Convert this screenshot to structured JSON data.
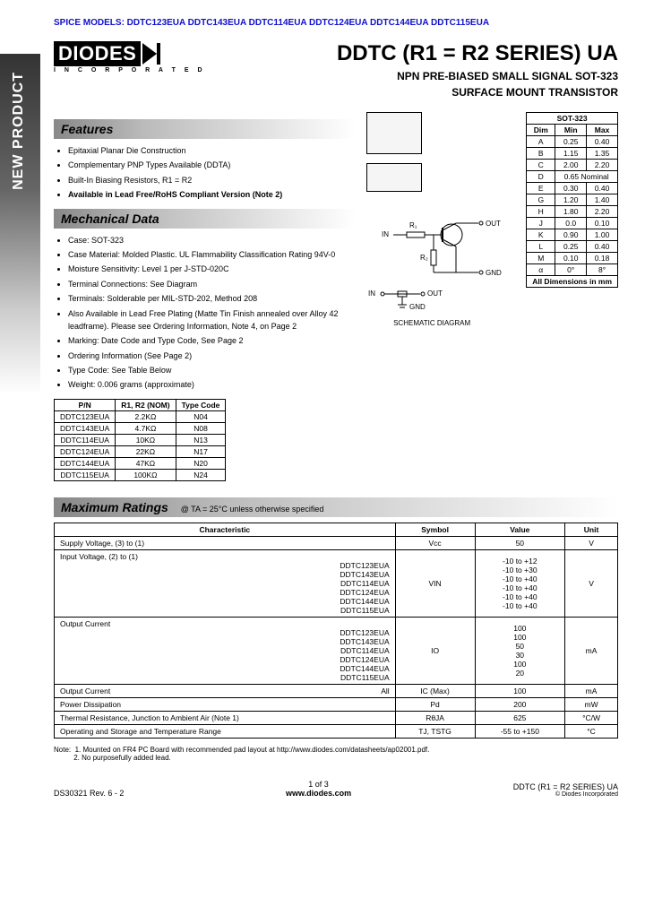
{
  "spice_header": "SPICE MODELS:  DDTC123EUA DDTC143EUA DDTC114EUA DDTC124EUA DDTC144EUA DDTC115EUA",
  "logo": {
    "text": "DIODES",
    "sub": "I N C O R P O R A T E D"
  },
  "title": {
    "main": "DDTC (R1 = R2 SERIES) UA",
    "sub1": "NPN PRE-BIASED SMALL SIGNAL SOT-323",
    "sub2": "SURFACE MOUNT TRANSISTOR"
  },
  "sidebar": "NEW PRODUCT",
  "features": {
    "head": "Features",
    "items": [
      "Epitaxial Planar Die Construction",
      "Complementary PNP Types Available (DDTA)",
      "Built-In Biasing Resistors, R1 = R2",
      "Available in Lead Free/RoHS Compliant Version (Note 2)"
    ]
  },
  "mech": {
    "head": "Mechanical Data",
    "items": [
      "Case: SOT-323",
      "Case Material: Molded Plastic. UL Flammability Classification Rating 94V-0",
      "Moisture Sensitivity: Level 1 per J-STD-020C",
      "Terminal Connections: See Diagram",
      "Terminals: Solderable per MIL-STD-202, Method 208",
      "Also Available in Lead Free Plating (Matte Tin Finish annealed over Alloy 42 leadframe). Please see Ordering Information, Note 4, on Page 2",
      "Marking: Date Code and Type Code, See Page 2",
      "Ordering Information (See Page 2)",
      "Type Code: See Table Below",
      "Weight: 0.006 grams (approximate)"
    ]
  },
  "pn_table": {
    "headers": [
      "P/N",
      "R1, R2 (NOM)",
      "Type Code"
    ],
    "rows": [
      [
        "DDTC123EUA",
        "2.2KΩ",
        "N04"
      ],
      [
        "DDTC143EUA",
        "4.7KΩ",
        "N08"
      ],
      [
        "DDTC114EUA",
        "10KΩ",
        "N13"
      ],
      [
        "DDTC124EUA",
        "22KΩ",
        "N17"
      ],
      [
        "DDTC144EUA",
        "47KΩ",
        "N20"
      ],
      [
        "DDTC115EUA",
        "100KΩ",
        "N24"
      ]
    ]
  },
  "dim_table": {
    "title": "SOT-323",
    "headers": [
      "Dim",
      "Min",
      "Max"
    ],
    "rows": [
      [
        "A",
        "0.25",
        "0.40"
      ],
      [
        "B",
        "1.15",
        "1.35"
      ],
      [
        "C",
        "2.00",
        "2.20"
      ],
      [
        "D",
        "0.65 Nominal",
        ""
      ],
      [
        "E",
        "0.30",
        "0.40"
      ],
      [
        "G",
        "1.20",
        "1.40"
      ],
      [
        "H",
        "1.80",
        "2.20"
      ],
      [
        "J",
        "0.0",
        "0.10"
      ],
      [
        "K",
        "0.90",
        "1.00"
      ],
      [
        "L",
        "0.25",
        "0.40"
      ],
      [
        "M",
        "0.10",
        "0.18"
      ],
      [
        "α",
        "0°",
        "8°"
      ]
    ],
    "footer": "All Dimensions in mm"
  },
  "schematic": {
    "in": "IN",
    "out": "OUT",
    "gnd": "GND",
    "r1": "R₁",
    "r2": "R₂",
    "label": "SCHEMATIC DIAGRAM"
  },
  "max": {
    "head": "Maximum Ratings",
    "cond": "@ TA = 25°C unless otherwise specified",
    "headers": [
      "Characteristic",
      "Symbol",
      "Value",
      "Unit"
    ],
    "rows": [
      {
        "char": "Supply Voltage, (3) to (1)",
        "sym": "Vcc",
        "val": "50",
        "unit": "V"
      }
    ],
    "input_row": {
      "char": "Input Voltage, (2) to (1)",
      "parts": [
        "DDTC123EUA",
        "DDTC143EUA",
        "DDTC114EUA",
        "DDTC124EUA",
        "DDTC144EUA",
        "DDTC115EUA"
      ],
      "sym": "VIN",
      "vals": [
        "-10 to +12",
        "-10 to +30",
        "-10 to +40",
        "-10 to +40",
        "-10 to +40",
        "-10 to +40"
      ],
      "unit": "V"
    },
    "output_row": {
      "char": "Output Current",
      "parts": [
        "DDTC123EUA",
        "DDTC143EUA",
        "DDTC114EUA",
        "DDTC124EUA",
        "DDTC144EUA",
        "DDTC115EUA"
      ],
      "sym": "IO",
      "vals": [
        "100",
        "100",
        "50",
        "30",
        "100",
        "20"
      ],
      "unit": "mA"
    },
    "tail_rows": [
      {
        "char": "Output Current",
        "p": "All",
        "sym": "IC (Max)",
        "val": "100",
        "unit": "mA"
      },
      {
        "char": "Power Dissipation",
        "p": "",
        "sym": "Pd",
        "val": "200",
        "unit": "mW"
      },
      {
        "char": "Thermal Resistance, Junction to Ambient Air (Note 1)",
        "p": "",
        "sym": "RθJA",
        "val": "625",
        "unit": "°C/W"
      },
      {
        "char": "Operating and Storage and Temperature Range",
        "p": "",
        "sym": "TJ, TSTG",
        "val": "-55 to +150",
        "unit": "°C"
      }
    ]
  },
  "notes": {
    "label": "Note:",
    "n1": "1. Mounted on FR4 PC Board with recommended pad layout at http://www.diodes.com/datasheets/ap02001.pdf.",
    "n2": "2. No purposefully added lead."
  },
  "footer": {
    "left": "DS30321 Rev. 6 - 2",
    "mid_page": "1 of 3",
    "mid_url": "www.diodes.com",
    "right": "DDTC (R1 = R2 SERIES) UA",
    "copy": "© Diodes Incorporated"
  }
}
